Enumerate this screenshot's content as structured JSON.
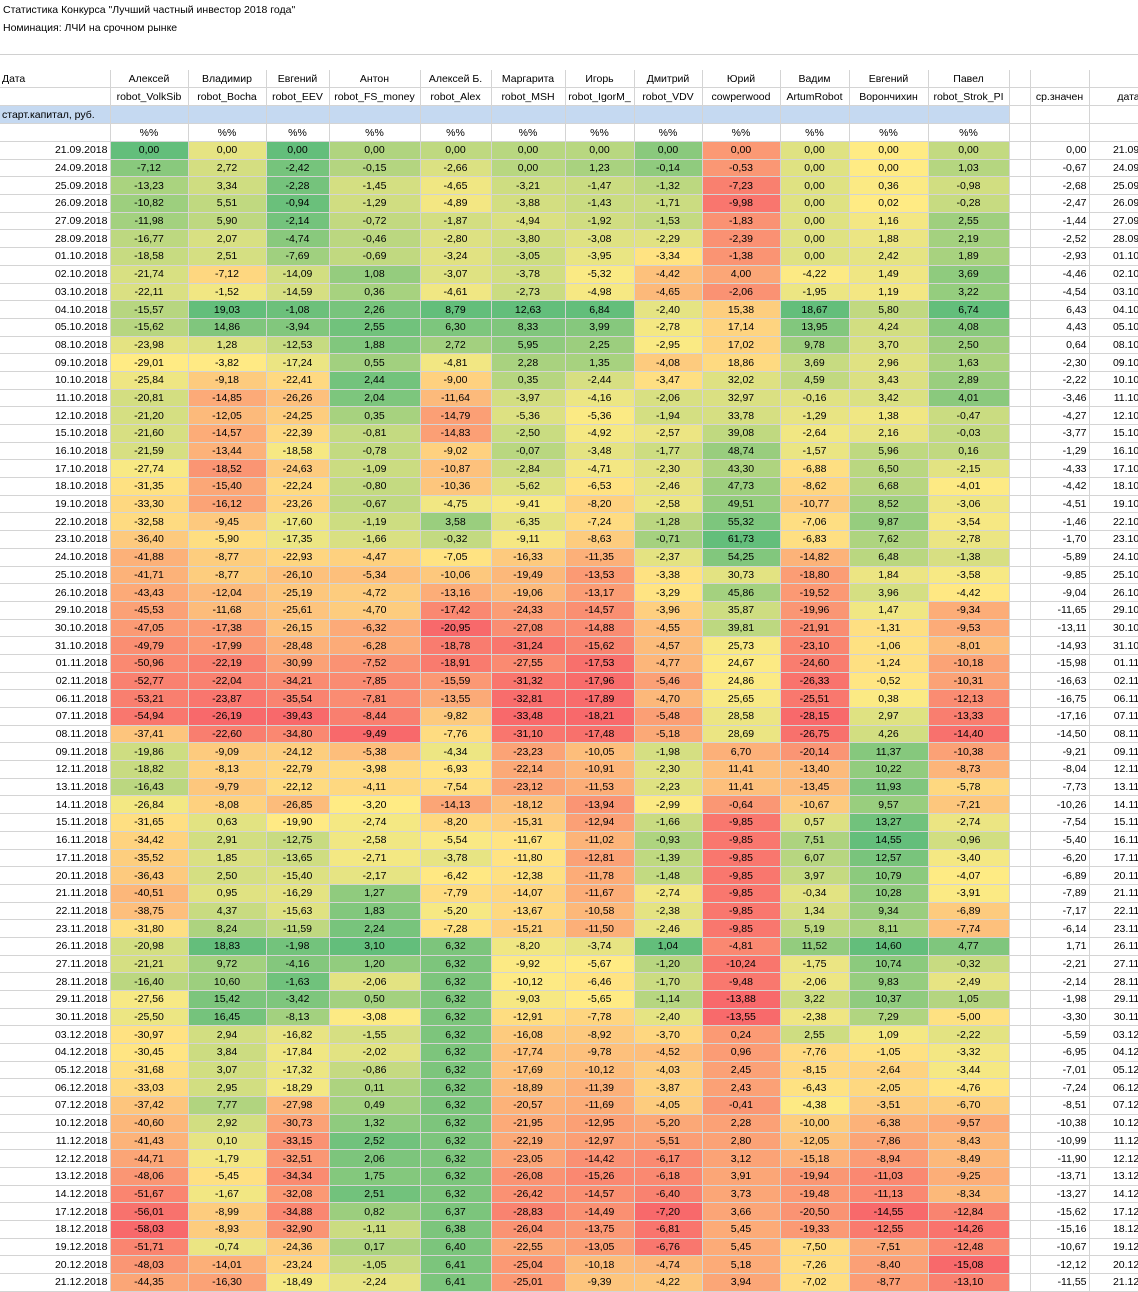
{
  "title": "Статистика Конкурса \"Лучший частный инвестор 2018 года\"",
  "nomination": "Номинация: ЛЧИ на срочном рынке",
  "header": {
    "date_label": "Дата",
    "start_capital_label": "старт.капитал, руб.",
    "avg_label": "ср.значен",
    "date2_label": "дата",
    "pct_label": "%%"
  },
  "participants": [
    {
      "name": "Алексей",
      "nick": "robot_VolkSib"
    },
    {
      "name": "Владимир",
      "nick": "robot_Bocha"
    },
    {
      "name": "Евгений",
      "nick": "robot_EEV"
    },
    {
      "name": "Антон",
      "nick": "robot_FS_money"
    },
    {
      "name": "Алексей Б.",
      "nick": "robot_Alex"
    },
    {
      "name": "Маргарита",
      "nick": "robot_MSH"
    },
    {
      "name": "Игорь",
      "nick": "robot_IgorM_"
    },
    {
      "name": "Дмитрий",
      "nick": "robot_VDV"
    },
    {
      "name": "Юрий",
      "nick": "cowperwood"
    },
    {
      "name": "Вадим",
      "nick": "ArtumRobot"
    },
    {
      "name": "Евгений",
      "nick": "Ворончихин"
    },
    {
      "name": "Павел",
      "nick": "robot_Strok_PI"
    }
  ],
  "rows": [
    [
      "21.09.2018",
      "0,00",
      "0,00",
      "0,00",
      "0,00",
      "0,00",
      "0,00",
      "0,00",
      "0,00",
      "0,00",
      "0,00",
      "0,00",
      "0,00",
      "0,00"
    ],
    [
      "24.09.2018",
      "-7,12",
      "2,72",
      "-2,42",
      "-0,15",
      "-2,66",
      "0,00",
      "1,23",
      "-0,14",
      "-0,53",
      "0,00",
      "0,00",
      "1,03",
      "-0,67"
    ],
    [
      "25.09.2018",
      "-13,23",
      "3,34",
      "-2,28",
      "-1,45",
      "-4,65",
      "-3,21",
      "-1,47",
      "-1,32",
      "-7,23",
      "0,00",
      "0,36",
      "-0,98",
      "-2,68"
    ],
    [
      "26.09.2018",
      "-10,82",
      "5,51",
      "-0,94",
      "-1,29",
      "-4,89",
      "-3,88",
      "-1,43",
      "-1,71",
      "-9,98",
      "0,00",
      "0,02",
      "-0,28",
      "-2,47"
    ],
    [
      "27.09.2018",
      "-11,98",
      "5,90",
      "-2,14",
      "-0,72",
      "-1,87",
      "-4,94",
      "-1,92",
      "-1,53",
      "-1,83",
      "0,00",
      "1,16",
      "2,55",
      "-1,44"
    ],
    [
      "28.09.2018",
      "-16,77",
      "2,07",
      "-4,74",
      "-0,46",
      "-2,80",
      "-3,80",
      "-3,08",
      "-2,29",
      "-2,39",
      "0,00",
      "1,88",
      "2,19",
      "-2,52"
    ],
    [
      "01.10.2018",
      "-18,58",
      "2,51",
      "-7,69",
      "-0,69",
      "-3,24",
      "-3,05",
      "-3,95",
      "-3,34",
      "-1,38",
      "0,00",
      "2,42",
      "1,89",
      "-2,93"
    ],
    [
      "02.10.2018",
      "-21,74",
      "-7,12",
      "-14,09",
      "1,08",
      "-3,07",
      "-3,78",
      "-5,32",
      "-4,42",
      "4,00",
      "-4,22",
      "1,49",
      "3,69",
      "-4,46"
    ],
    [
      "03.10.2018",
      "-22,11",
      "-1,52",
      "-14,59",
      "0,36",
      "-4,61",
      "-2,73",
      "-4,98",
      "-4,65",
      "-2,06",
      "-1,95",
      "1,19",
      "3,22",
      "-4,54"
    ],
    [
      "04.10.2018",
      "-15,57",
      "19,03",
      "-1,08",
      "2,26",
      "8,79",
      "12,63",
      "6,84",
      "-2,40",
      "15,38",
      "18,67",
      "5,80",
      "6,74",
      "6,43"
    ],
    [
      "05.10.2018",
      "-15,62",
      "14,86",
      "-3,94",
      "2,55",
      "6,30",
      "8,33",
      "3,99",
      "-2,78",
      "17,14",
      "13,95",
      "4,24",
      "4,08",
      "4,43"
    ],
    [
      "08.10.2018",
      "-23,98",
      "1,28",
      "-12,53",
      "1,88",
      "2,72",
      "5,95",
      "2,25",
      "-2,95",
      "17,02",
      "9,78",
      "3,70",
      "2,50",
      "0,64"
    ],
    [
      "09.10.2018",
      "-29,01",
      "-3,82",
      "-17,24",
      "0,55",
      "-4,81",
      "2,28",
      "1,35",
      "-4,08",
      "18,86",
      "3,69",
      "2,96",
      "1,63",
      "-2,30"
    ],
    [
      "10.10.2018",
      "-25,84",
      "-9,18",
      "-22,41",
      "2,44",
      "-9,00",
      "0,35",
      "-2,44",
      "-3,47",
      "32,02",
      "4,59",
      "3,43",
      "2,89",
      "-2,22"
    ],
    [
      "11.10.2018",
      "-20,81",
      "-14,85",
      "-26,26",
      "2,04",
      "-11,64",
      "-3,97",
      "-4,16",
      "-2,06",
      "32,97",
      "-0,16",
      "3,42",
      "4,01",
      "-3,46"
    ],
    [
      "12.10.2018",
      "-21,20",
      "-12,05",
      "-24,25",
      "0,35",
      "-14,79",
      "-5,36",
      "-5,36",
      "-1,94",
      "33,78",
      "-1,29",
      "1,38",
      "-0,47",
      "-4,27"
    ],
    [
      "15.10.2018",
      "-21,60",
      "-14,57",
      "-22,39",
      "-0,81",
      "-14,83",
      "-2,50",
      "-4,92",
      "-2,57",
      "39,08",
      "-2,64",
      "2,16",
      "-0,03",
      "-3,77"
    ],
    [
      "16.10.2018",
      "-21,59",
      "-13,44",
      "-18,58",
      "-0,78",
      "-9,02",
      "-0,07",
      "-3,48",
      "-1,77",
      "48,74",
      "-1,57",
      "5,96",
      "0,16",
      "-1,29"
    ],
    [
      "17.10.2018",
      "-27,74",
      "-18,52",
      "-24,63",
      "-1,09",
      "-10,87",
      "-2,84",
      "-4,71",
      "-2,30",
      "43,30",
      "-6,88",
      "6,50",
      "-2,15",
      "-4,33"
    ],
    [
      "18.10.2018",
      "-31,35",
      "-15,40",
      "-22,24",
      "-0,80",
      "-10,36",
      "-5,62",
      "-6,53",
      "-2,46",
      "47,73",
      "-8,62",
      "6,68",
      "-4,01",
      "-4,42"
    ],
    [
      "19.10.2018",
      "-33,30",
      "-16,12",
      "-23,26",
      "-0,67",
      "-4,75",
      "-9,41",
      "-8,20",
      "-2,58",
      "49,51",
      "-10,77",
      "8,52",
      "-3,06",
      "-4,51"
    ],
    [
      "22.10.2018",
      "-32,58",
      "-9,45",
      "-17,60",
      "-1,19",
      "3,58",
      "-6,35",
      "-7,24",
      "-1,28",
      "55,32",
      "-7,06",
      "9,87",
      "-3,54",
      "-1,46"
    ],
    [
      "23.10.2018",
      "-36,40",
      "-5,90",
      "-17,35",
      "-1,66",
      "-0,32",
      "-9,11",
      "-8,63",
      "-0,71",
      "61,73",
      "-6,83",
      "7,62",
      "-2,78",
      "-1,70"
    ],
    [
      "24.10.2018",
      "-41,88",
      "-8,77",
      "-22,93",
      "-4,47",
      "-7,05",
      "-16,33",
      "-11,35",
      "-2,37",
      "54,25",
      "-14,82",
      "6,48",
      "-1,38",
      "-5,89"
    ],
    [
      "25.10.2018",
      "-41,71",
      "-8,77",
      "-26,10",
      "-5,34",
      "-10,06",
      "-19,49",
      "-13,53",
      "-3,38",
      "30,73",
      "-18,80",
      "1,84",
      "-3,58",
      "-9,85"
    ],
    [
      "26.10.2018",
      "-43,43",
      "-12,04",
      "-25,19",
      "-4,72",
      "-13,16",
      "-19,06",
      "-13,17",
      "-3,29",
      "45,86",
      "-19,52",
      "3,96",
      "-4,42",
      "-9,04"
    ],
    [
      "29.10.2018",
      "-45,53",
      "-11,68",
      "-25,61",
      "-4,70",
      "-17,42",
      "-24,33",
      "-14,57",
      "-3,96",
      "35,87",
      "-19,96",
      "1,47",
      "-9,34",
      "-11,65"
    ],
    [
      "30.10.2018",
      "-47,05",
      "-17,38",
      "-26,15",
      "-6,32",
      "-20,95",
      "-27,08",
      "-14,88",
      "-4,55",
      "39,81",
      "-21,91",
      "-1,31",
      "-9,53",
      "-13,11"
    ],
    [
      "31.10.2018",
      "-49,79",
      "-17,99",
      "-28,48",
      "-6,28",
      "-18,78",
      "-31,24",
      "-15,62",
      "-4,57",
      "25,73",
      "-23,10",
      "-1,06",
      "-8,01",
      "-14,93"
    ],
    [
      "01.11.2018",
      "-50,96",
      "-22,19",
      "-30,99",
      "-7,52",
      "-18,91",
      "-27,55",
      "-17,53",
      "-4,77",
      "24,67",
      "-24,60",
      "-1,24",
      "-10,18",
      "-15,98"
    ],
    [
      "02.11.2018",
      "-52,77",
      "-22,04",
      "-34,21",
      "-7,85",
      "-15,59",
      "-31,32",
      "-17,96",
      "-5,46",
      "24,86",
      "-26,33",
      "-0,52",
      "-10,31",
      "-16,63"
    ],
    [
      "06.11.2018",
      "-53,21",
      "-23,87",
      "-35,54",
      "-7,81",
      "-13,55",
      "-32,81",
      "-17,89",
      "-4,70",
      "25,65",
      "-25,51",
      "0,38",
      "-12,13",
      "-16,75"
    ],
    [
      "07.11.2018",
      "-54,94",
      "-26,19",
      "-39,43",
      "-8,44",
      "-9,82",
      "-33,48",
      "-18,21",
      "-5,48",
      "28,58",
      "-28,15",
      "2,97",
      "-13,33",
      "-17,16"
    ],
    [
      "08.11.2018",
      "-37,41",
      "-22,60",
      "-34,80",
      "-9,49",
      "-7,76",
      "-31,10",
      "-17,48",
      "-5,18",
      "28,69",
      "-26,75",
      "4,26",
      "-14,40",
      "-14,50"
    ],
    [
      "09.11.2018",
      "-19,86",
      "-9,09",
      "-24,12",
      "-5,38",
      "-4,34",
      "-23,23",
      "-10,05",
      "-1,98",
      "6,70",
      "-20,14",
      "11,37",
      "-10,38",
      "-9,21"
    ],
    [
      "12.11.2018",
      "-18,82",
      "-8,13",
      "-22,79",
      "-3,98",
      "-6,93",
      "-22,14",
      "-10,91",
      "-2,30",
      "11,41",
      "-13,40",
      "10,22",
      "-8,73",
      "-8,04"
    ],
    [
      "13.11.2018",
      "-16,43",
      "-9,79",
      "-22,12",
      "-4,11",
      "-7,54",
      "-23,12",
      "-11,53",
      "-2,23",
      "11,41",
      "-13,45",
      "11,93",
      "-5,78",
      "-7,73"
    ],
    [
      "14.11.2018",
      "-26,84",
      "-8,08",
      "-26,85",
      "-3,20",
      "-14,13",
      "-18,12",
      "-13,94",
      "-2,99",
      "-0,64",
      "-10,67",
      "9,57",
      "-7,21",
      "-10,26"
    ],
    [
      "15.11.2018",
      "-31,65",
      "0,63",
      "-19,90",
      "-2,74",
      "-8,20",
      "-15,31",
      "-12,94",
      "-1,66",
      "-9,85",
      "0,57",
      "13,27",
      "-2,74",
      "-7,54"
    ],
    [
      "16.11.2018",
      "-34,42",
      "2,91",
      "-12,75",
      "-2,58",
      "-5,54",
      "-11,67",
      "-11,02",
      "-0,93",
      "-9,85",
      "7,51",
      "14,55",
      "-0,96",
      "-5,40"
    ],
    [
      "17.11.2018",
      "-35,52",
      "1,85",
      "-13,65",
      "-2,71",
      "-3,78",
      "-11,80",
      "-12,81",
      "-1,39",
      "-9,85",
      "6,07",
      "12,57",
      "-3,40",
      "-6,20"
    ],
    [
      "20.11.2018",
      "-36,43",
      "2,50",
      "-15,40",
      "-2,17",
      "-6,42",
      "-12,38",
      "-11,78",
      "-1,48",
      "-9,85",
      "3,97",
      "10,79",
      "-4,07",
      "-6,89"
    ],
    [
      "21.11.2018",
      "-40,51",
      "0,95",
      "-16,29",
      "1,27",
      "-7,79",
      "-14,07",
      "-11,67",
      "-2,74",
      "-9,85",
      "-0,34",
      "10,28",
      "-3,91",
      "-7,89"
    ],
    [
      "22.11.2018",
      "-38,75",
      "4,37",
      "-15,63",
      "1,83",
      "-5,20",
      "-13,67",
      "-10,58",
      "-2,38",
      "-9,85",
      "1,34",
      "9,34",
      "-6,89",
      "-7,17"
    ],
    [
      "23.11.2018",
      "-31,80",
      "8,24",
      "-11,59",
      "2,24",
      "-7,28",
      "-15,21",
      "-11,50",
      "-2,46",
      "-9,85",
      "5,19",
      "8,11",
      "-7,74",
      "-6,14"
    ],
    [
      "26.11.2018",
      "-20,98",
      "18,83",
      "-1,98",
      "3,10",
      "6,32",
      "-8,20",
      "-3,74",
      "1,04",
      "-4,81",
      "11,52",
      "14,60",
      "4,77",
      "1,71"
    ],
    [
      "27.11.2018",
      "-21,21",
      "9,72",
      "-4,16",
      "1,20",
      "6,32",
      "-9,92",
      "-5,67",
      "-1,20",
      "-10,24",
      "-1,75",
      "10,74",
      "-0,32",
      "-2,21"
    ],
    [
      "28.11.2018",
      "-16,40",
      "10,60",
      "-1,63",
      "-2,06",
      "6,32",
      "-10,12",
      "-6,46",
      "-1,70",
      "-9,48",
      "-2,06",
      "9,83",
      "-2,49",
      "-2,14"
    ],
    [
      "29.11.2018",
      "-27,56",
      "15,42",
      "-3,42",
      "0,50",
      "6,32",
      "-9,03",
      "-5,65",
      "-1,14",
      "-13,88",
      "3,22",
      "10,37",
      "1,05",
      "-1,98"
    ],
    [
      "30.11.2018",
      "-25,50",
      "16,45",
      "-8,13",
      "-3,08",
      "6,32",
      "-12,91",
      "-7,78",
      "-2,40",
      "-13,55",
      "-2,38",
      "7,29",
      "-5,00",
      "-3,30"
    ],
    [
      "03.12.2018",
      "-30,97",
      "2,94",
      "-16,82",
      "-1,55",
      "6,32",
      "-16,08",
      "-8,92",
      "-3,70",
      "0,24",
      "2,55",
      "1,09",
      "-2,22",
      "-5,59"
    ],
    [
      "04.12.2018",
      "-30,45",
      "3,84",
      "-17,84",
      "-2,02",
      "6,32",
      "-17,74",
      "-9,78",
      "-4,52",
      "0,96",
      "-7,76",
      "-1,05",
      "-3,32",
      "-6,95"
    ],
    [
      "05.12.2018",
      "-31,68",
      "3,07",
      "-17,32",
      "-0,86",
      "6,32",
      "-17,69",
      "-10,12",
      "-4,03",
      "2,45",
      "-8,15",
      "-2,64",
      "-3,44",
      "-7,01"
    ],
    [
      "06.12.2018",
      "-33,03",
      "2,95",
      "-18,29",
      "0,11",
      "6,32",
      "-18,89",
      "-11,39",
      "-3,87",
      "2,43",
      "-6,43",
      "-2,05",
      "-4,76",
      "-7,24"
    ],
    [
      "07.12.2018",
      "-37,42",
      "7,77",
      "-27,98",
      "0,49",
      "6,32",
      "-20,57",
      "-11,69",
      "-4,05",
      "-0,41",
      "-4,38",
      "-3,51",
      "-6,70",
      "-8,51"
    ],
    [
      "10.12.2018",
      "-40,60",
      "2,92",
      "-30,73",
      "1,32",
      "6,32",
      "-21,95",
      "-12,95",
      "-5,20",
      "2,28",
      "-10,00",
      "-6,38",
      "-9,57",
      "-10,38"
    ],
    [
      "11.12.2018",
      "-41,43",
      "0,10",
      "-33,15",
      "2,52",
      "6,32",
      "-22,19",
      "-12,97",
      "-5,51",
      "2,80",
      "-12,05",
      "-7,86",
      "-8,43",
      "-10,99"
    ],
    [
      "12.12.2018",
      "-44,71",
      "-1,79",
      "-32,51",
      "2,06",
      "6,32",
      "-23,05",
      "-14,42",
      "-6,17",
      "3,12",
      "-15,18",
      "-8,94",
      "-8,49",
      "-11,90"
    ],
    [
      "13.12.2018",
      "-48,06",
      "-5,45",
      "-34,34",
      "1,75",
      "6,32",
      "-26,08",
      "-15,26",
      "-6,18",
      "3,91",
      "-19,94",
      "-11,03",
      "-9,25",
      "-13,71"
    ],
    [
      "14.12.2018",
      "-51,67",
      "-1,67",
      "-32,08",
      "2,51",
      "6,32",
      "-26,42",
      "-14,57",
      "-6,40",
      "3,73",
      "-19,48",
      "-11,13",
      "-8,34",
      "-13,27"
    ],
    [
      "17.12.2018",
      "-56,01",
      "-8,99",
      "-34,88",
      "0,82",
      "6,37",
      "-28,83",
      "-14,49",
      "-7,20",
      "3,66",
      "-20,50",
      "-14,55",
      "-12,84",
      "-15,62"
    ],
    [
      "18.12.2018",
      "-58,03",
      "-8,93",
      "-32,90",
      "-1,11",
      "6,38",
      "-26,04",
      "-13,75",
      "-6,81",
      "5,45",
      "-19,33",
      "-12,55",
      "-14,26",
      "-15,16"
    ],
    [
      "19.12.2018",
      "-51,71",
      "-0,74",
      "-24,36",
      "0,17",
      "6,40",
      "-22,55",
      "-13,05",
      "-6,76",
      "5,45",
      "-7,50",
      "-7,51",
      "-12,48",
      "-10,67"
    ],
    [
      "20.12.2018",
      "-48,03",
      "-14,01",
      "-23,24",
      "-1,05",
      "6,41",
      "-25,04",
      "-10,18",
      "-4,74",
      "5,18",
      "-7,26",
      "-8,40",
      "-15,08",
      "-12,12"
    ],
    [
      "21.12.2018",
      "-44,35",
      "-16,30",
      "-18,49",
      "-2,24",
      "6,41",
      "-25,01",
      "-9,39",
      "-4,22",
      "3,94",
      "-7,02",
      "-8,77",
      "-13,10",
      "-11,55"
    ]
  ]
}
